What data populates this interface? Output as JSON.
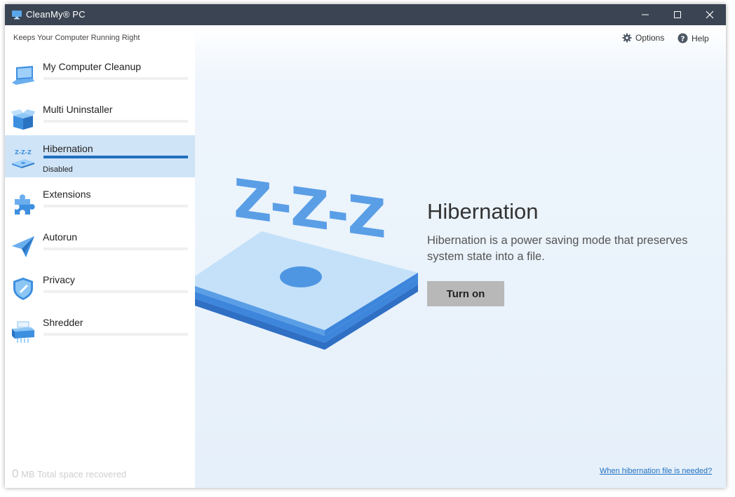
{
  "window": {
    "title": "CleanMy® PC"
  },
  "sidebar": {
    "tagline": "Keeps Your Computer Running Right",
    "items": [
      {
        "label": "My Computer Cleanup",
        "icon": "laptop-icon"
      },
      {
        "label": "Multi Uninstaller",
        "icon": "box-icon"
      },
      {
        "label": "Hibernation",
        "icon": "hibernation-icon",
        "status": "Disabled",
        "active": true
      },
      {
        "label": "Extensions",
        "icon": "puzzle-icon"
      },
      {
        "label": "Autorun",
        "icon": "paper-plane-icon"
      },
      {
        "label": "Privacy",
        "icon": "shield-icon"
      },
      {
        "label": "Shredder",
        "icon": "shredder-icon"
      }
    ],
    "space_value": "0",
    "space_unit": "MB Total space recovered"
  },
  "topbar": {
    "options_label": "Options",
    "help_label": "Help"
  },
  "main": {
    "illustration_text": "Z-Z-Z",
    "title": "Hibernation",
    "description": "Hibernation is a power saving mode that preserves system state into a file.",
    "button_label": "Turn on",
    "help_link": "When hibernation file is needed?"
  },
  "colors": {
    "titlebar": "#3a4452",
    "accent": "#1f6fc0",
    "active_item": "#cfe4f7",
    "illustration_blue": "#5a9ee6"
  }
}
